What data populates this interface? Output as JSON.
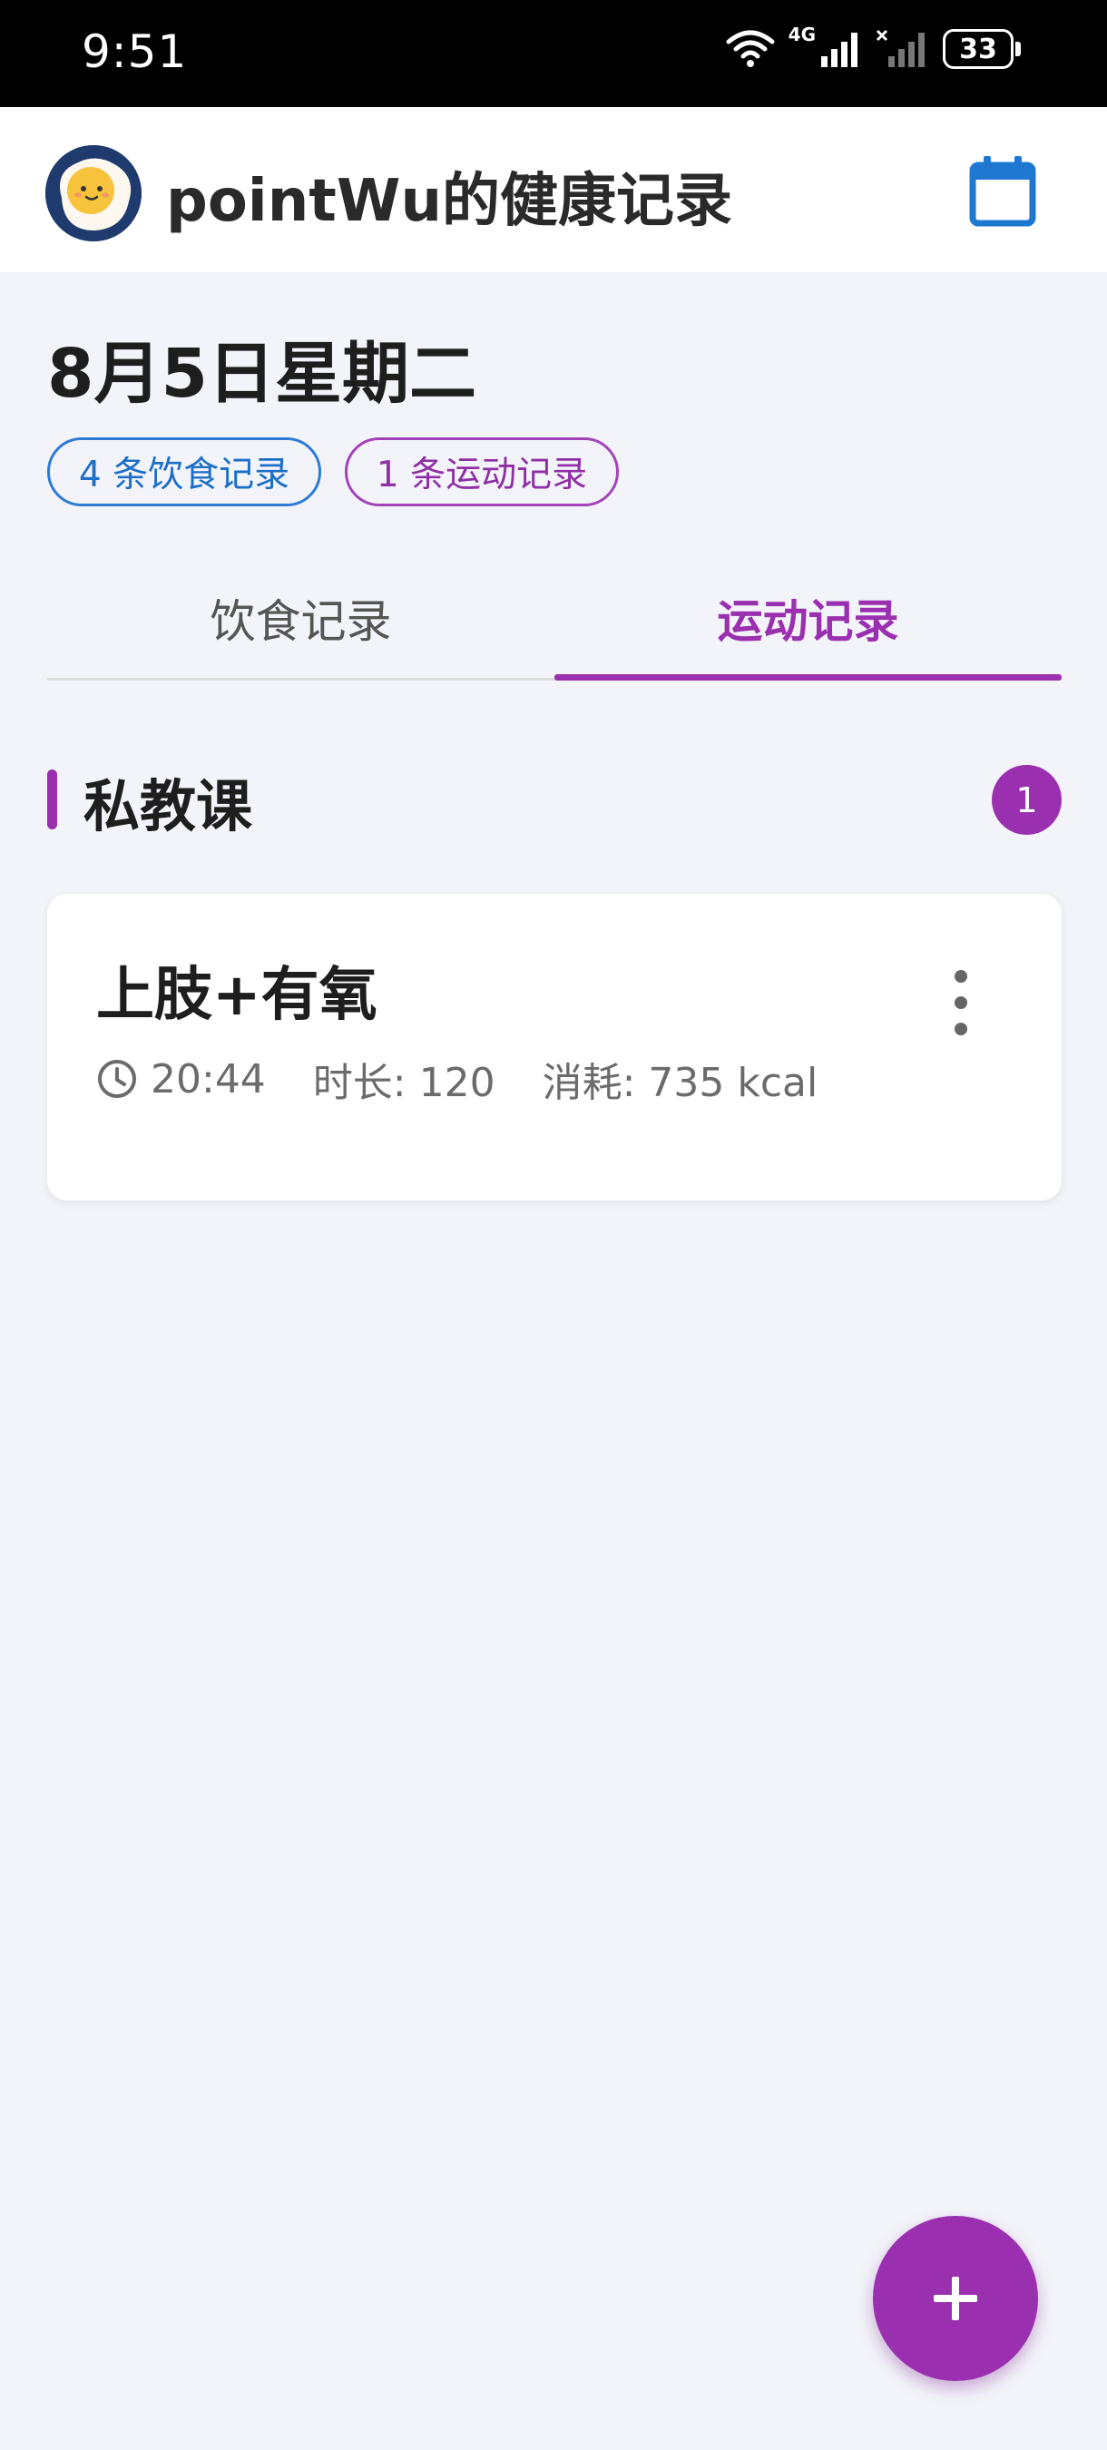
{
  "status_bar": {
    "time": "9:51",
    "network": "4G",
    "battery": "33"
  },
  "app_bar": {
    "title": "pointWu的健康记录",
    "avatar_icon": "egg-avatar-icon",
    "calendar_icon": "calendar-icon"
  },
  "date": {
    "title": "8月5日星期二",
    "diet_chip": "4 条饮食记录",
    "exercise_chip": "1 条运动记录"
  },
  "tabs": [
    {
      "label": "饮食记录",
      "active": false
    },
    {
      "label": "运动记录",
      "active": true
    }
  ],
  "section": {
    "title": "私教课",
    "count": "1"
  },
  "records": [
    {
      "title": "上肢+有氧",
      "time": "20:44",
      "duration": "时长: 120",
      "calories": "消耗: 735 kcal"
    }
  ],
  "colors": {
    "accent": "#9a2fb0",
    "diet_blue": "#2d7bd6",
    "background": "#f3f4f9"
  },
  "fab": {
    "icon": "plus-icon"
  }
}
